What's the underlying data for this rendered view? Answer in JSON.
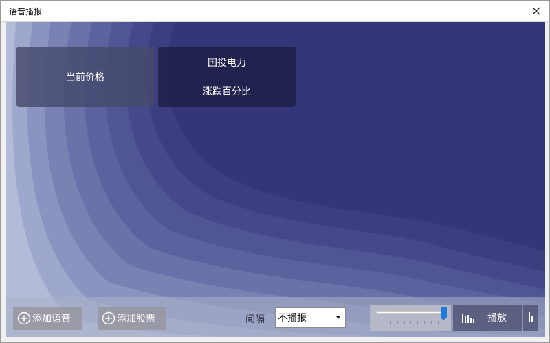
{
  "window": {
    "title": "语音播报",
    "close_icon": "close-icon"
  },
  "cards": [
    {
      "label": "当前价格"
    },
    {
      "name": "国投电力",
      "label": "涨跌百分比"
    }
  ],
  "toolbar": {
    "add_voice_label": "添加语音",
    "add_stock_label": "添加股票",
    "interval_label": "间隔",
    "interval_value": "不播报",
    "volume_level": 1.0,
    "play_label": "播放"
  },
  "colors": {
    "background": "#35367a",
    "slider_thumb": "#1e7ad8"
  },
  "icons": [
    "close-icon",
    "plus-circle-icon",
    "chevron-down-icon",
    "sound-bars-icon"
  ]
}
